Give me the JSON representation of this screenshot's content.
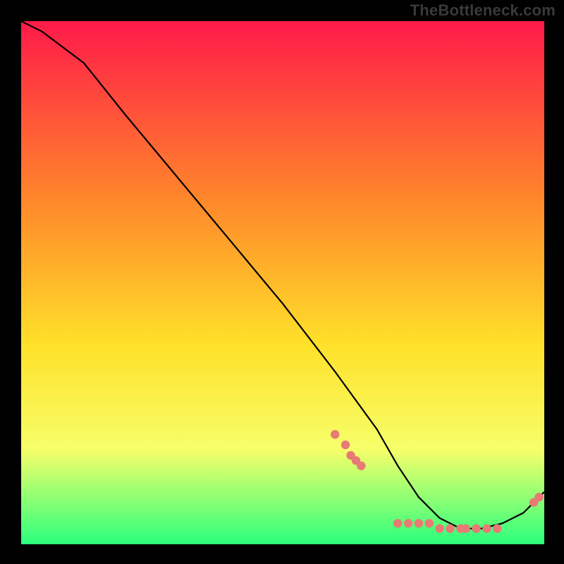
{
  "watermark": "TheBottleneck.com",
  "colors": {
    "background": "#000000",
    "gradient_top": "#ff1a49",
    "gradient_mid1": "#ff8a2a",
    "gradient_mid2": "#ffe12a",
    "gradient_mid3": "#f6ff6a",
    "gradient_bottom": "#2bff7d",
    "curve": "#000000",
    "dots": "#e77a74"
  },
  "chart_data": {
    "type": "line",
    "title": "",
    "xlabel": "",
    "ylabel": "",
    "xlim": [
      0,
      100
    ],
    "ylim": [
      0,
      100
    ],
    "grid": false,
    "legend": false,
    "series": [
      {
        "name": "bottleneck-curve",
        "x": [
          0,
          4,
          8,
          12,
          20,
          30,
          40,
          50,
          60,
          68,
          72,
          76,
          80,
          84,
          88,
          92,
          96,
          100
        ],
        "y": [
          100,
          98,
          95,
          92,
          82,
          70,
          58,
          46,
          33,
          22,
          15,
          9,
          5,
          3,
          3,
          4,
          6,
          10
        ]
      }
    ],
    "scatter": [
      {
        "name": "measured-points",
        "x": [
          60,
          62,
          63,
          64,
          65,
          72,
          74,
          76,
          78,
          80,
          82,
          84,
          85,
          87,
          89,
          91,
          98,
          99
        ],
        "y": [
          21,
          19,
          17,
          16,
          15,
          4,
          4,
          4,
          4,
          3,
          3,
          3,
          3,
          3,
          3,
          3,
          8,
          9
        ]
      }
    ]
  }
}
